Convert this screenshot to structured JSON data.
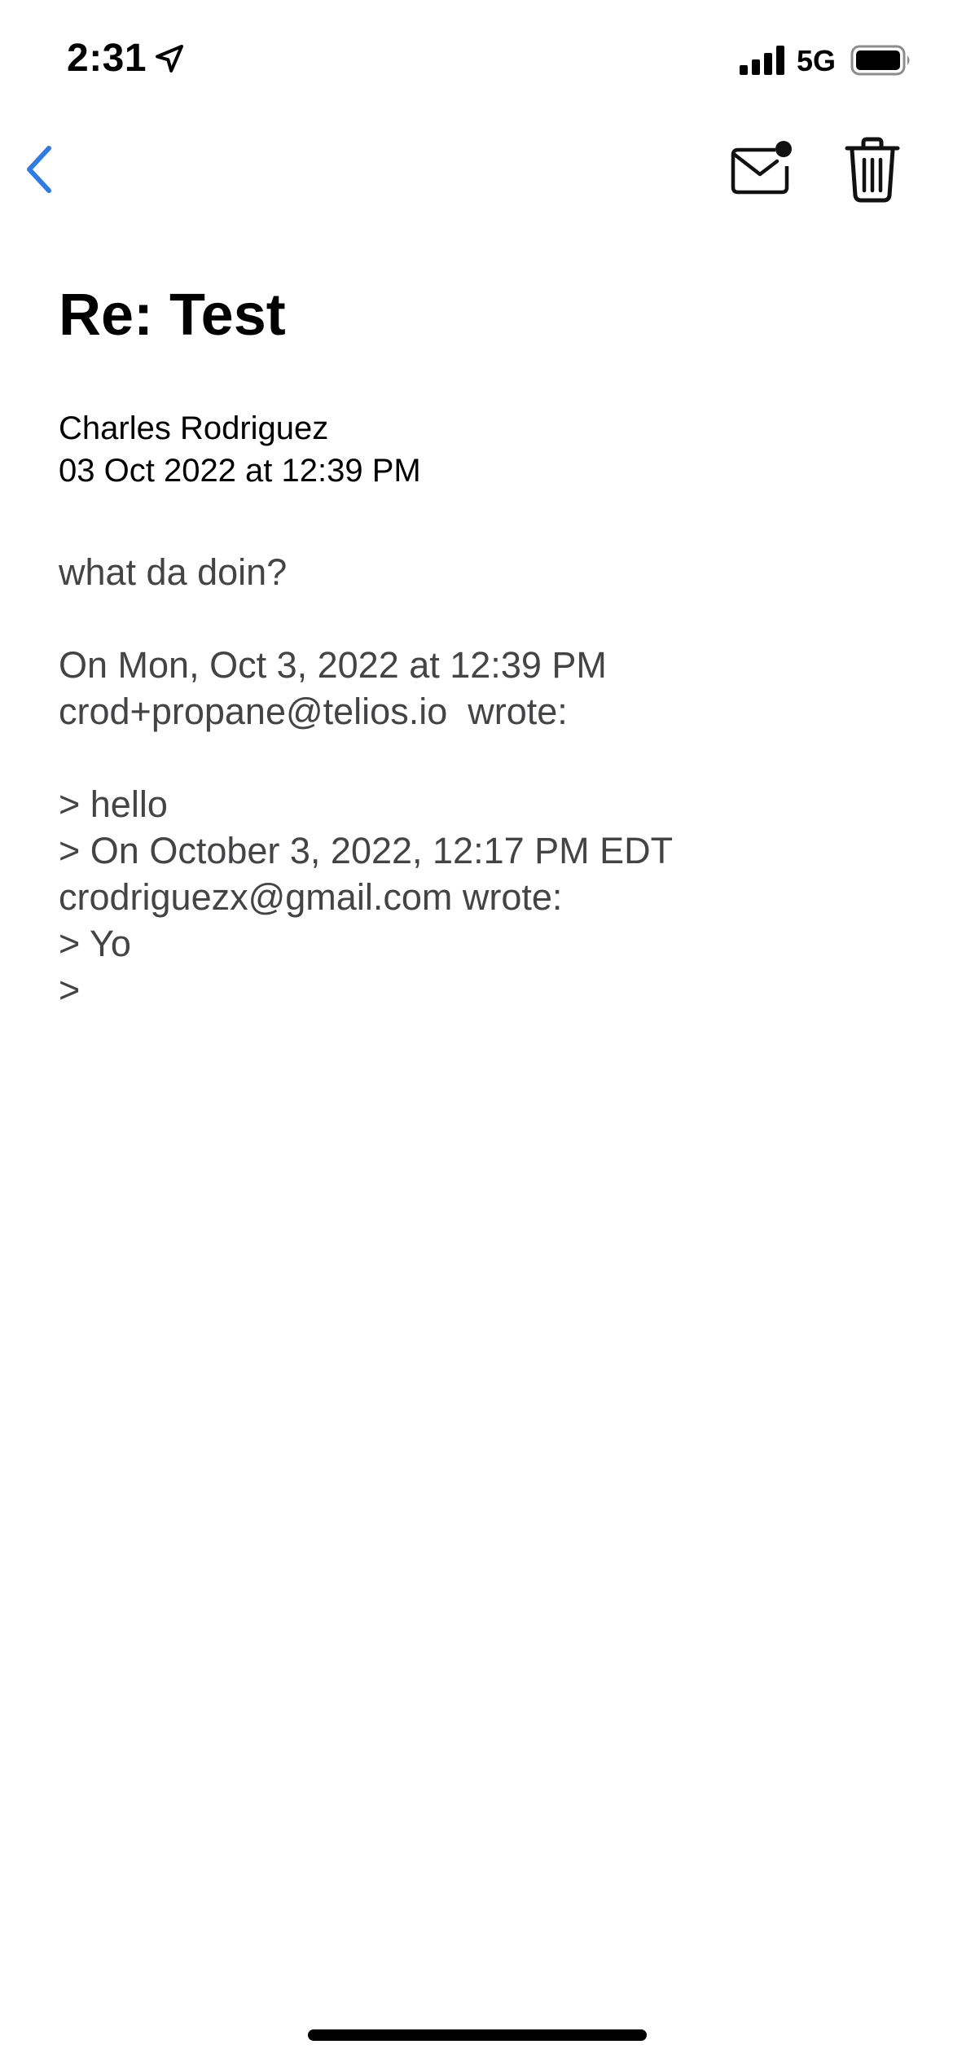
{
  "status_bar": {
    "time": "2:31",
    "network": "5G",
    "icons": [
      "location-arrow-icon",
      "signal-bars-icon",
      "battery-icon"
    ]
  },
  "nav": {
    "icons": [
      "chevron-left-icon",
      "mail-unread-icon",
      "trash-icon"
    ],
    "accent_color": "#2F7AE5"
  },
  "email": {
    "subject": "Re: Test",
    "sender": "Charles Rodriguez",
    "date": "03 Oct 2022 at 12:39 PM",
    "body_lines": [
      "what da doin?",
      "",
      "On Mon, Oct 3, 2022 at 12:39 PM",
      "crod+propane@telios.io  wrote:",
      "",
      "> hello",
      "> On October 3, 2022, 12:17 PM EDT",
      "crodriguezx@gmail.com wrote:",
      "> Yo",
      ">"
    ]
  }
}
